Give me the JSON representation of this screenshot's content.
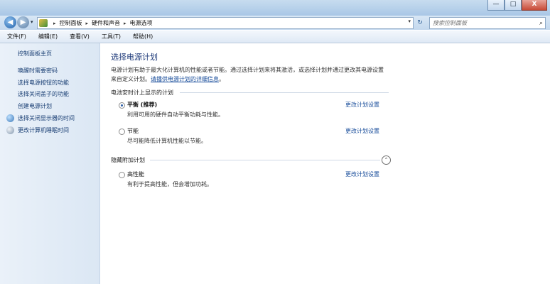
{
  "window": {
    "controls": {
      "minimize": "—",
      "maximize": "□",
      "close": "X"
    }
  },
  "address": {
    "breadcrumbs": [
      "控制面板",
      "硬件和声音",
      "电源选项"
    ],
    "dropdown_glyph": "▾",
    "refresh_glyph": "↻"
  },
  "search": {
    "placeholder": "搜索控制面板",
    "icon": "search-icon"
  },
  "menu": {
    "items": [
      "文件(F)",
      "编辑(E)",
      "查看(V)",
      "工具(T)",
      "帮助(H)"
    ]
  },
  "sidebar": {
    "home": "控制面板主页",
    "links": [
      "唤醒时需要密码",
      "选择电源按钮的功能",
      "选择关闭盖子的功能",
      "创建电源计划",
      "选择关闭显示器的时间",
      "更改计算机睡眠时间"
    ]
  },
  "main": {
    "title": "选择电源计划",
    "desc_line1": "电源计划有助于最大化计算机的性能或者节能。通过选择计划来将其激活，或选择计划并通过更改其电源设置",
    "desc_line2_prefix": "来自定义计划。",
    "desc_link": "请播供电源计划的详细信息",
    "desc_line2_suffix": "。",
    "group_battery": "电池安时计上显示的计划",
    "group_hidden": "隐藏附加计划",
    "plans": [
      {
        "name": "平衡 (推荐)",
        "desc": "利用可用的硬件自动平衡功耗与性能。",
        "link": "更改计划设置",
        "selected": true
      },
      {
        "name": "节能",
        "desc": "尽可能降低计算机性能以节能。",
        "link": "更改计划设置",
        "selected": false
      },
      {
        "name": "高性能",
        "desc": "有利于提高性能，但会增加功耗。",
        "link": "更改计划设置",
        "selected": false
      }
    ],
    "collapse_glyph": "⌃"
  },
  "help_glyph": "?"
}
